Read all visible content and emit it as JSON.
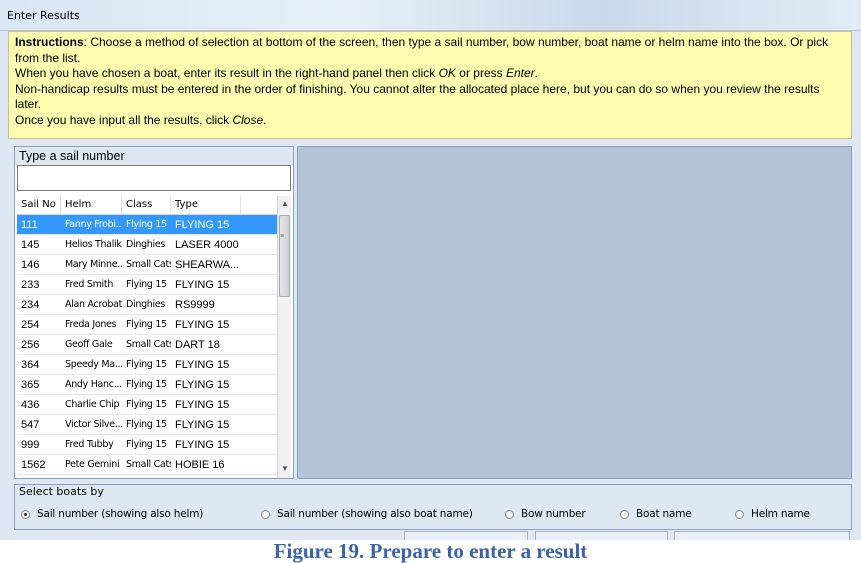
{
  "window": {
    "title": "Enter Results"
  },
  "instructions": {
    "label": "Instructions",
    "line1_rest": ": Choose a method of selection at bottom of the screen, then type a sail number, bow number, boat name or helm name into the box. Or pick from the list.",
    "line2_a": "When you have chosen a boat, enter its result in the right-hand panel then click ",
    "line2_ok": "OK",
    "line2_b": " or press ",
    "line2_enter": "Enter",
    "line2_c": ".",
    "line3": "Non-handicap results must be entered in the order of finishing. You cannot alter the allocated place here, but you can do so when you review the results later.",
    "line4_a": "Once you have input all the results, click ",
    "line4_close": "Close",
    "line4_b": "."
  },
  "search": {
    "prompt": "Type a sail number",
    "value": ""
  },
  "list": {
    "headers": [
      "Sail No",
      "Helm",
      "Class",
      "Type"
    ],
    "rows": [
      [
        "111",
        "Fanny Frobi...",
        "Flying 15",
        "FLYING 15"
      ],
      [
        "145",
        "Helios Thalik",
        "Dinghies",
        "LASER 4000"
      ],
      [
        "146",
        "Mary Minne...",
        "Small Cats",
        "SHEARWA..."
      ],
      [
        "233",
        "Fred Smith",
        "Flying 15",
        "FLYING 15"
      ],
      [
        "234",
        "Alan Acrobat",
        "Dinghies",
        "RS9999"
      ],
      [
        "254",
        "Freda Jones",
        "Flying 15",
        "FLYING 15"
      ],
      [
        "256",
        "Geoff Gale",
        "Small Cats",
        "DART 18"
      ],
      [
        "364",
        "Speedy Ma...",
        "Flying 15",
        "FLYING 15"
      ],
      [
        "365",
        "Andy Hanc...",
        "Flying 15",
        "FLYING 15"
      ],
      [
        "436",
        "Charlie Chip",
        "Flying 15",
        "FLYING 15"
      ],
      [
        "547",
        "Victor Silve...",
        "Flying 15",
        "FLYING 15"
      ],
      [
        "999",
        "Fred Tubby",
        "Flying 15",
        "FLYING 15"
      ],
      [
        "1562",
        "Pete Gemini",
        "Small Cats",
        "HOBIE 16"
      ]
    ],
    "selected_index": 0
  },
  "select_by": {
    "legend": "Select boats by",
    "options": [
      "Sail number (showing also helm)",
      "Sail number (showing also boat name)",
      "Bow number",
      "Boat name",
      "Helm name"
    ],
    "selected_index": 0
  },
  "caption": "Figure 19. Prepare to enter a result"
}
